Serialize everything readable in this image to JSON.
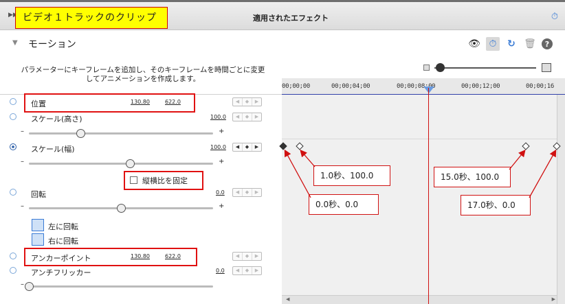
{
  "panel": {
    "track_label": "ビデオ１トラックのクリップ",
    "title": "適用されたエフェクト"
  },
  "section": {
    "name": "モーション"
  },
  "description": "パラメーターにキーフレームを追加し、そのキーフレームを時間ごとに変更してアニメーションを作成します。",
  "params": {
    "position": {
      "label": "位置",
      "x": "130.80",
      "y": "622.0"
    },
    "scale_height": {
      "label": "スケール(高さ)",
      "value": "100.0",
      "slider": 0.28
    },
    "scale_width": {
      "label": "スケール(幅)",
      "value": "100.0",
      "slider": 0.55
    },
    "lock_ratio": {
      "label": "縦横比を固定",
      "checked": false
    },
    "rotation": {
      "label": "回転",
      "value": "0.0",
      "slider": 0.5
    },
    "rotate_left": "左に回転",
    "rotate_right": "右に回転",
    "anchor": {
      "label": "アンカーポイント",
      "x": "130.80",
      "y": "622.0"
    },
    "anti_flicker": {
      "label": "アンチフリッカー",
      "value": "0.0",
      "slider": 0.0
    }
  },
  "timeline": {
    "ticks": [
      "00;00;00",
      "00;00;04;00",
      "00;00;08;00",
      "00;00;12;00",
      "00;00;16"
    ],
    "callouts": {
      "kf1": "1.0秒、100.0",
      "kf0": "0.0秒、0.0",
      "kf15": "15.0秒、100.0",
      "kf17": "17.0秒、0.0"
    }
  },
  "colors": {
    "track_label_bg": "#ffff00",
    "annotation_red": "#d01010",
    "playhead": "#d01010",
    "stopwatch": "#3a7bd5"
  }
}
